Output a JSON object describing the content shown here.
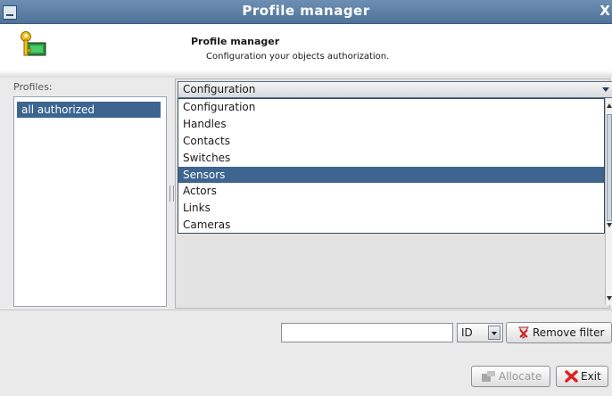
{
  "window": {
    "title": "Profile manager",
    "close_glyph": "X",
    "menu_icon": "window-menu-icon"
  },
  "header": {
    "title": "Profile manager",
    "subtitle": "Configuration your objects authorization.",
    "icon": "key-profile-icon"
  },
  "profiles": {
    "label": "Profiles:",
    "items": [
      {
        "label": "all authorized",
        "selected": true
      }
    ]
  },
  "category_select": {
    "selected": "Configuration",
    "options": [
      {
        "label": "Configuration",
        "highlighted": false
      },
      {
        "label": "Handles",
        "highlighted": false
      },
      {
        "label": "Contacts",
        "highlighted": false
      },
      {
        "label": "Switches",
        "highlighted": false
      },
      {
        "label": "Sensors",
        "highlighted": true
      },
      {
        "label": "Actors",
        "highlighted": false
      },
      {
        "label": "Links",
        "highlighted": false
      },
      {
        "label": "Cameras",
        "highlighted": false
      }
    ]
  },
  "filter": {
    "input_value": "",
    "field_select": "ID",
    "remove_filter_label": "Remove filter"
  },
  "buttons": {
    "allocate": "Allocate",
    "exit": "Exit"
  },
  "colors": {
    "selection": "#3d6590",
    "titlebar": "#5a7ea4",
    "exit_icon": "#e02020"
  }
}
